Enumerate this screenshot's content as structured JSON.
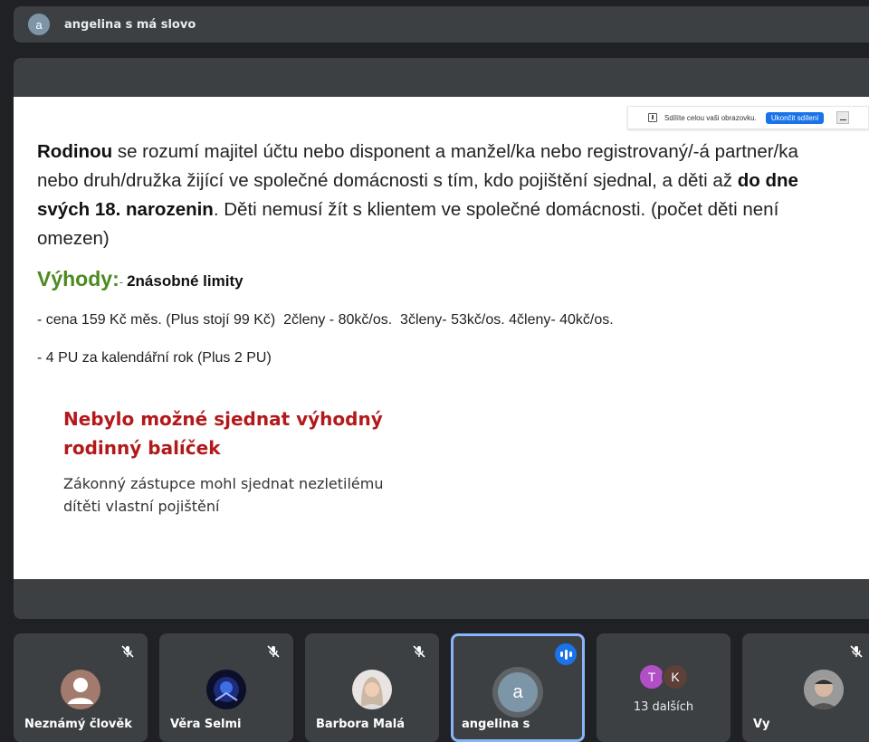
{
  "speaker_bar": {
    "avatar_letter": "a",
    "text": "angelina s má slovo"
  },
  "share_notice": {
    "text": "Sdílíte celou vaši obrazovku.",
    "stop_button": "Ukončit sdílení"
  },
  "slide": {
    "p1_bold1": "Rodinou",
    "p1_text1": " se rozumí majitel účtu nebo disponent a manžel/ka nebo registrovaný/-á partner/ka nebo druh/družka žijící ve společné domácnosti s tím, kdo pojištění sjednal, a děti až ",
    "p1_bold2": "do dne svých 18. narozenin",
    "p1_text2": ". Děti nemusí žít s klientem ve společné domácnosti. (počet děti není omezen)",
    "benefits_title": "Výhody:",
    "benefits_dash": "- ",
    "benefits_sub": "2násobné limity",
    "line1": "- cena 159 Kč měs. (Plus stojí 99 Kč)  2členy - 80kč/os.  3členy- 53kč/os. 4členy- 40kč/os.",
    "line2": "- 4 PU za kalendářní rok (Plus 2 PU)",
    "red_title_1": "Nebylo možné sjednat výhodný",
    "red_title_2": "rodinný balíček",
    "red_sub_1": "Zákonný zástupce mohl sjednat nezletilému",
    "red_sub_2": "dítěti vlastní pojištění"
  },
  "participants": [
    {
      "name": "Neznámý člověk"
    },
    {
      "name": "Věra Selmi"
    },
    {
      "name": "Barbora Malá"
    },
    {
      "name": "angelina s",
      "avatar_letter": "a"
    },
    {
      "more_label": "13 dalších",
      "letters": [
        "T",
        "K"
      ]
    },
    {
      "name": "Vy"
    }
  ],
  "colors": {
    "active_border": "#8ab4f8",
    "speaking": "#1a73e8",
    "benefits": "#4e8a1f",
    "red_title": "#b3191b"
  }
}
